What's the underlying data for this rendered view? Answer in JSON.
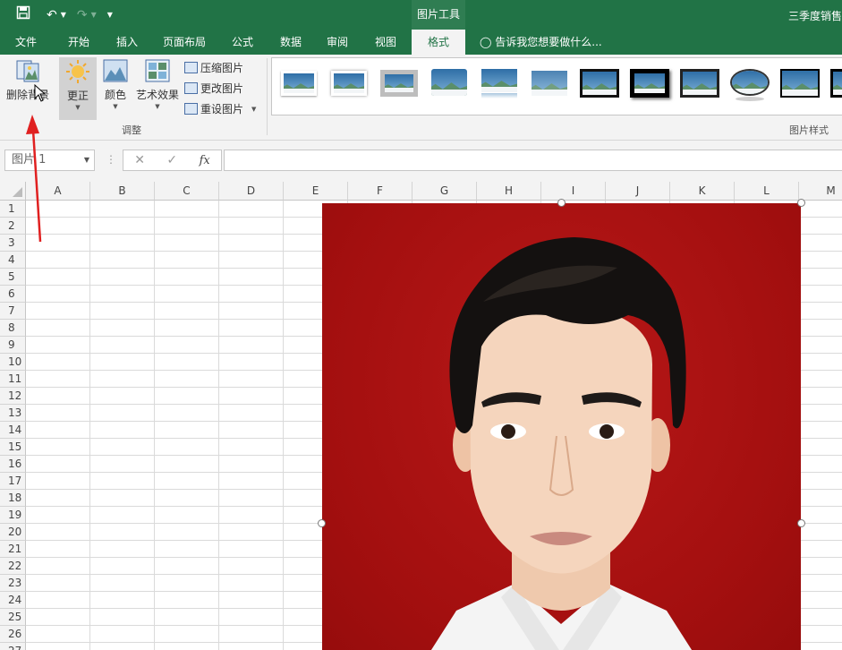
{
  "titlebar": {
    "picture_tools_label": "图片工具",
    "doc_title": "三季度销售"
  },
  "tabs": [
    "文件",
    "开始",
    "插入",
    "页面布局",
    "公式",
    "数据",
    "审阅",
    "视图",
    "格式"
  ],
  "active_tab": "格式",
  "tell_me": "告诉我您想要做什么...",
  "ribbon": {
    "remove_background": "删除背景",
    "corrections": "更正",
    "color": "颜色",
    "artistic_effects": "艺术效果",
    "compress_pictures": "压缩图片",
    "change_picture": "更改图片",
    "reset_picture": "重设图片",
    "adjust_group": "调整",
    "picture_styles_group": "图片样式"
  },
  "formula_bar": {
    "name_box": "图片 1",
    "fx_label": "fx",
    "value": ""
  },
  "columns": [
    "A",
    "B",
    "C",
    "D",
    "E",
    "F",
    "G",
    "H",
    "I",
    "J",
    "K",
    "L",
    "M"
  ],
  "rows": [
    "1",
    "2",
    "3",
    "4",
    "5",
    "6",
    "7",
    "8",
    "9",
    "10",
    "11",
    "12",
    "13",
    "14",
    "15",
    "16",
    "17",
    "18",
    "19",
    "20",
    "21",
    "22",
    "23",
    "24",
    "25",
    "26",
    "27"
  ],
  "colors": {
    "excel_green": "#217346",
    "photo_background": "#a81010",
    "annotation_arrow": "#e02020"
  }
}
